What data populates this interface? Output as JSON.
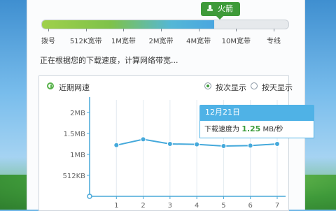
{
  "speed_bar": {
    "badge_label": "火箭",
    "fill_fraction": 0.7,
    "labels": [
      "拨号",
      "512K宽带",
      "1M宽带",
      "2M宽带",
      "4M宽带",
      "10M宽带",
      "专线"
    ]
  },
  "status_text": "正在根据您的下载速度，计算网络带宽...",
  "panel": {
    "title": "近期网速",
    "radio_by_count": "按次显示",
    "radio_by_day": "按天显示",
    "selected": "按次显示"
  },
  "tooltip": {
    "date": "12月21日",
    "speed_label": "下载速度为",
    "speed_value": "1.25",
    "speed_unit": "MB/秒"
  },
  "chart_data": {
    "type": "line",
    "x": [
      1,
      2,
      3,
      4,
      5,
      6,
      7
    ],
    "y_ticks": [
      "512KB",
      "1MB",
      "1.5MB",
      "2MB"
    ],
    "y_ticks_values_mb": [
      0.5,
      1,
      1.5,
      2
    ],
    "ylim_mb": [
      0,
      2.3
    ],
    "series": [
      {
        "values_mb": [
          1.22,
          1.36,
          1.25,
          1.24,
          1.2,
          1.21,
          1.25
        ]
      }
    ],
    "colors": {
      "line": "#45a9db",
      "axis": "#49a8d8",
      "grid": "#e3eaf0"
    }
  }
}
